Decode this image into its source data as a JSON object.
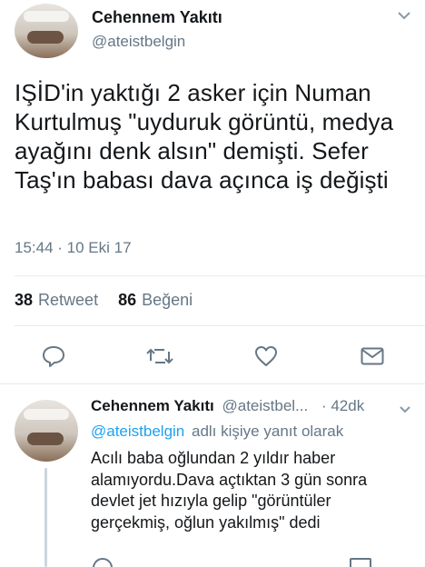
{
  "tweet": {
    "display_name": "Cehennem Yakıtı",
    "handle": "@ateistbelgin",
    "text": "IŞİD'in yaktığı 2 asker için Numan Kurtulmuş \"uyduruk görüntü, medya ayağını denk alsın\" demişti. Sefer Taş'ın babası dava açınca iş değişti",
    "time": "15:44 · 10 Eki 17",
    "retweets": {
      "count": "38",
      "label": "Retweet"
    },
    "likes": {
      "count": "86",
      "label": "Beğeni"
    }
  },
  "actions": {
    "reply_icon": "reply-icon",
    "retweet_icon": "retweet-icon",
    "like_icon": "heart-icon",
    "dm_icon": "envelope-icon"
  },
  "reply": {
    "display_name": "Cehennem Yakıtı",
    "handle_truncated": "@ateistbel...",
    "age": "· 42dk",
    "reply_to_handle": "@ateistbelgin",
    "reply_to_suffix": "adlı kişiye yanıt olarak",
    "text": "Acılı baba oğlundan 2 yıldır haber alamıyordu.Dava açtıktan 3 gün sonra devlet jet hızıyla gelip \"görüntüler gerçekmiş, oğlun yakılmış\" dedi"
  },
  "colors": {
    "link": "#1da1f2",
    "muted": "#657786",
    "divider": "#e6ecf0",
    "icon": "#657786"
  }
}
